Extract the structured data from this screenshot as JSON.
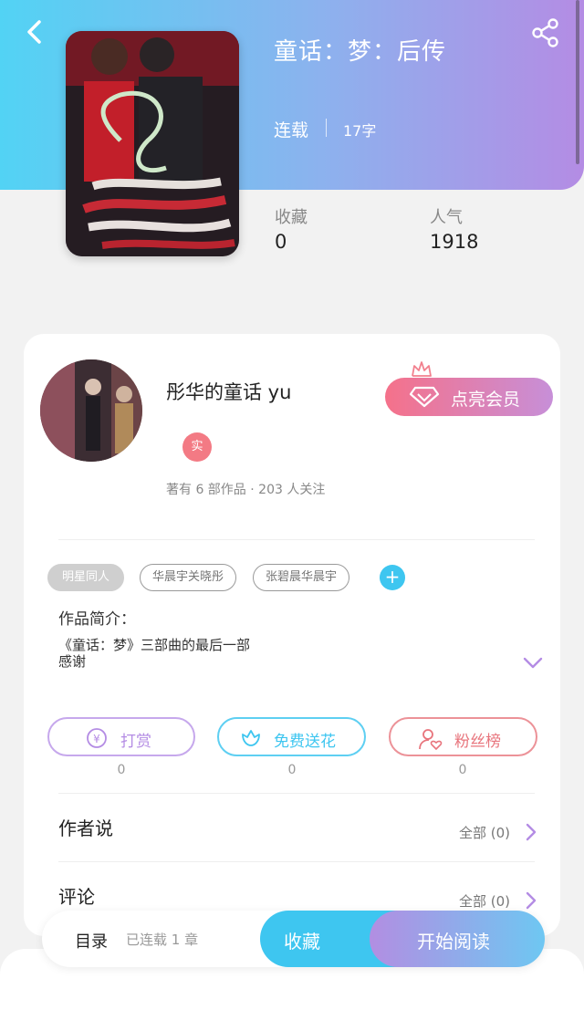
{
  "header": {
    "title": "童话：梦：后传",
    "status": "连载",
    "word_count": "17字"
  },
  "stats": {
    "favorites_label": "收藏",
    "favorites_value": "0",
    "popularity_label": "人气",
    "popularity_value": "1918"
  },
  "author": {
    "name": "彤华的童话 yu",
    "badge": "实",
    "meta": "著有 6 部作品 · 203 人关注",
    "vip_button": "点亮会员"
  },
  "tags": [
    "明星同人",
    "华晨宇关晓彤",
    "张碧晨华晨宇"
  ],
  "intro": {
    "label": "作品简介：",
    "line1": "《童话：梦》三部曲的最后一部",
    "line2": "感谢"
  },
  "actions": [
    {
      "label": "打赏",
      "count": "0",
      "color": "#b48ce4"
    },
    {
      "label": "免费送花",
      "count": "0",
      "color": "#3ec6f0"
    },
    {
      "label": "粉丝榜",
      "count": "0",
      "color": "#e8757d"
    }
  ],
  "sections": {
    "author_says": {
      "title": "作者说",
      "all": "全部 (0)"
    },
    "comments": {
      "title": "评论",
      "all": "全部 (0)"
    }
  },
  "bottom_bar": {
    "toc_label": "目录",
    "toc_status": "已连载 1 章",
    "favorite_button": "收藏",
    "read_button": "开始阅读"
  }
}
